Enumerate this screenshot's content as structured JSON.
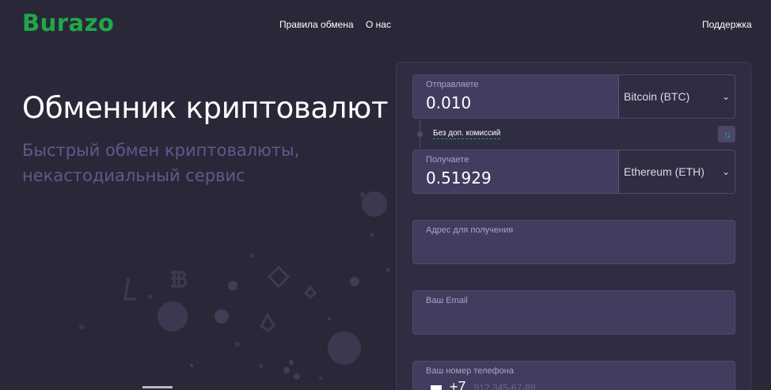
{
  "header": {
    "logo": "Burazo",
    "nav": {
      "rules": "Правила обмена",
      "about": "О нас",
      "support": "Поддержка"
    }
  },
  "hero": {
    "title": "Обменник криптовалют",
    "subtitle": "Быстрый обмен криптовалюты, некастодиальный сервис"
  },
  "exchange": {
    "send": {
      "label": "Отправляете",
      "value": "0.010",
      "currency": "Bitcoin (BTC)"
    },
    "no_fee": "Без доп. комиссий",
    "swap_icon": "swap-arrows-icon",
    "receive": {
      "label": "Получаете",
      "value": "0.51929",
      "currency": "Ethereum (ETH)"
    },
    "address": {
      "label": "Адрес для получения"
    },
    "email": {
      "label": "Ваш Email"
    },
    "phone": {
      "label": "Ваш номер телефона",
      "prefix": "+7",
      "placeholder": "912 345-67-89"
    }
  },
  "colors": {
    "background": "#2a2838",
    "brand": "#1fa84a",
    "panel": "#2f2d41",
    "field": "#403d5f",
    "subtitle": "#5e5a8c"
  }
}
